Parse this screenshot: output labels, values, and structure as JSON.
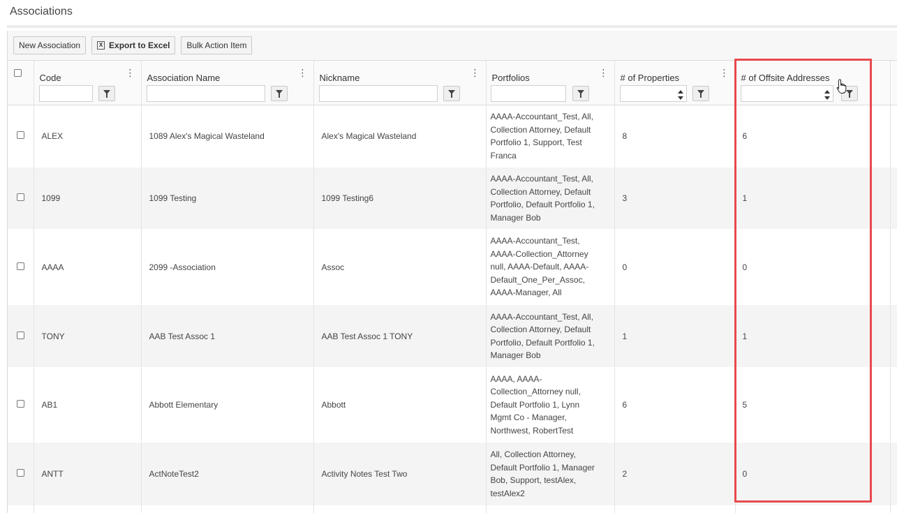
{
  "page": {
    "title": "Associations"
  },
  "toolbar": {
    "new_label": "New Association",
    "export_label": "Export to Excel",
    "export_icon": "excel-icon",
    "bulk_label": "Bulk Action Item"
  },
  "columns": [
    {
      "key": "code",
      "label": "Code"
    },
    {
      "key": "name",
      "label": "Association Name"
    },
    {
      "key": "nickname",
      "label": "Nickname"
    },
    {
      "key": "portfolios",
      "label": "Portfolios"
    },
    {
      "key": "properties",
      "label": "# of Properties"
    },
    {
      "key": "offsite",
      "label": "# of Offsite Addresses"
    }
  ],
  "rows": [
    {
      "code": "ALEX",
      "name": "1089 Alex's Magical Wasteland",
      "nickname": "Alex's Magical Wasteland",
      "portfolios": [
        "AAAA-Accountant_Test, All,",
        "Collection Attorney, Default",
        "Portfolio 1, Support, Test",
        "Franca"
      ],
      "properties": "8",
      "offsite": "6"
    },
    {
      "code": "1099",
      "name": "1099 Testing",
      "nickname": "1099 Testing6",
      "portfolios": [
        "AAAA-Accountant_Test, All,",
        "Collection Attorney, Default",
        "Portfolio, Default Portfolio 1,",
        "Manager Bob"
      ],
      "properties": "3",
      "offsite": "1"
    },
    {
      "code": "AAAA",
      "name": "2099 -Association",
      "nickname": "Assoc",
      "portfolios": [
        "AAAA-Accountant_Test,",
        "AAAA-Collection_Attorney",
        "null, AAAA-Default, AAAA-",
        "Default_One_Per_Assoc,",
        "AAAA-Manager, All"
      ],
      "properties": "0",
      "offsite": "0"
    },
    {
      "code": "TONY",
      "name": "AAB Test Assoc 1",
      "nickname": "AAB Test Assoc 1 TONY",
      "portfolios": [
        "AAAA-Accountant_Test, All,",
        "Collection Attorney, Default",
        "Portfolio, Default Portfolio 1,",
        "Manager Bob"
      ],
      "properties": "1",
      "offsite": "1"
    },
    {
      "code": "AB1",
      "name": "Abbott Elementary",
      "nickname": "Abbott",
      "portfolios": [
        "AAAA, AAAA-",
        "Collection_Attorney null,",
        "Default Portfolio 1, Lynn",
        "Mgmt Co - Manager,",
        "Northwest, RobertTest"
      ],
      "properties": "6",
      "offsite": "5"
    },
    {
      "code": "ANTT",
      "name": "ActNoteTest2",
      "nickname": "Activity Notes Test Two",
      "portfolios": [
        "All, Collection Attorney,",
        "Default Portfolio 1, Manager",
        "Bob, Support, testAlex,",
        "testAlex2"
      ],
      "properties": "2",
      "offsite": "0"
    }
  ],
  "colors": {
    "highlight": "#e8494d",
    "row_alt": "#f4f4f4"
  }
}
